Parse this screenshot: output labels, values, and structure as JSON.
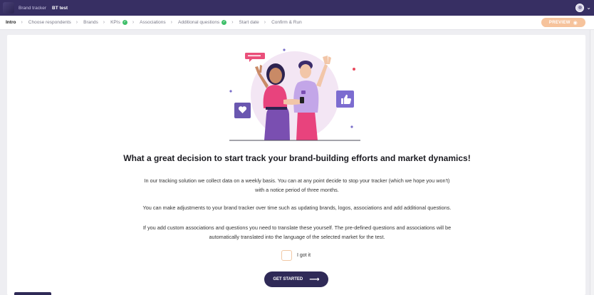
{
  "topbar": {
    "breadcrumb_app": "Brand tracker",
    "breadcrumb_project": "BT test",
    "chevron": "⌄"
  },
  "steps": [
    {
      "label": "Intro",
      "active": true,
      "done": false
    },
    {
      "label": "Choose respondents",
      "active": false,
      "done": false
    },
    {
      "label": "Brands",
      "active": false,
      "done": false
    },
    {
      "label": "KPIs",
      "active": false,
      "done": true
    },
    {
      "label": "Associations",
      "active": false,
      "done": false
    },
    {
      "label": "Additional questions",
      "active": false,
      "done": true
    },
    {
      "label": "Start date",
      "active": false,
      "done": false
    },
    {
      "label": "Confirm & Run",
      "active": false,
      "done": false
    }
  ],
  "preview": {
    "label": "PREVIEW",
    "icon": "eye-icon"
  },
  "content": {
    "headline": "What a great decision to start track your brand-building efforts and market dynamics!",
    "p1_line1": "In our tracking solution we collect data on a weekly basis. You can at any point decide to stop your tracker (which we hope you won't)",
    "p1_line2": "with a notice period of three months.",
    "p2": "You can make adjustments to your brand tracker over time such as updating brands, logos, associations and add additional questions.",
    "p3_line1": "If you add custom associations and questions you need to translate these yourself. The pre-defined questions and associations will be",
    "p3_line2": "automatically translated into the language of the selected market for the test.",
    "gotit_label": "I got it",
    "cta_label": "GET STARTED"
  },
  "colors": {
    "topbar": "#372f63",
    "accent_orange": "#f6c39c",
    "cta": "#2f2a57",
    "check_green": "#3fbf6a"
  }
}
